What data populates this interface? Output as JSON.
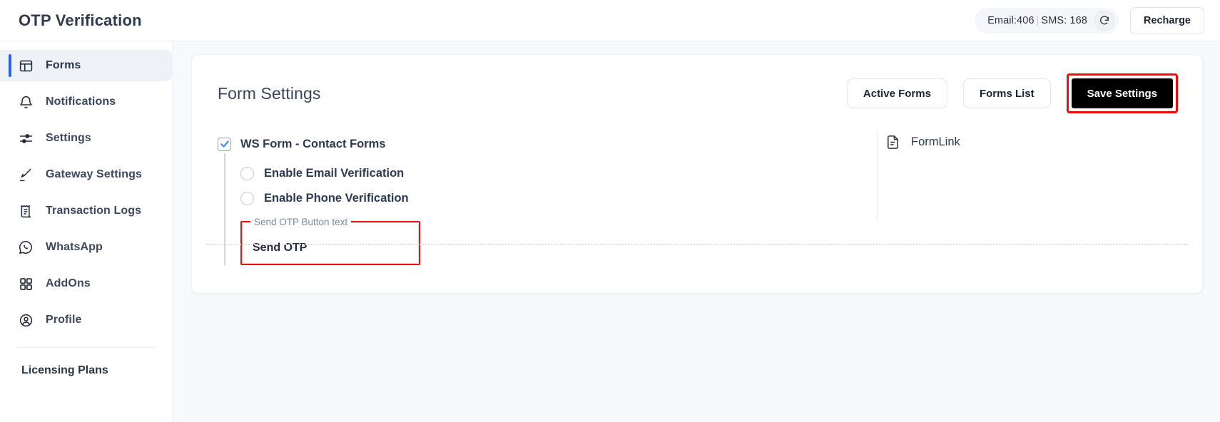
{
  "header": {
    "title": "OTP Verification",
    "credits": {
      "email_label": "Email:406",
      "separator": "|",
      "sms_label": "SMS: 168",
      "refresh_icon": "refresh-icon"
    },
    "recharge_label": "Recharge"
  },
  "sidebar": {
    "items": [
      {
        "label": "Forms",
        "icon": "layout-forms-icon",
        "active": true
      },
      {
        "label": "Notifications",
        "icon": "bell-icon",
        "active": false
      },
      {
        "label": "Settings",
        "icon": "sliders-icon",
        "active": false
      },
      {
        "label": "Gateway Settings",
        "icon": "brush-icon",
        "active": false
      },
      {
        "label": "Transaction Logs",
        "icon": "receipt-icon",
        "active": false
      },
      {
        "label": "WhatsApp",
        "icon": "whatsapp-icon",
        "active": false
      },
      {
        "label": "AddOns",
        "icon": "grid-squares-icon",
        "active": false
      },
      {
        "label": "Profile",
        "icon": "user-circle-icon",
        "active": false
      }
    ],
    "footer_item": "Licensing Plans"
  },
  "card": {
    "title": "Form Settings",
    "actions": {
      "active_forms": "Active Forms",
      "forms_list": "Forms List",
      "save_settings": "Save Settings"
    },
    "form": {
      "parent_checkbox": {
        "label": "WS Form - Contact Forms",
        "checked": true
      },
      "options": [
        {
          "label": "Enable Email Verification",
          "selected": false
        },
        {
          "label": "Enable Phone Verification",
          "selected": false
        }
      ],
      "otp_button_field": {
        "legend": "Send OTP Button text",
        "value": "Send OTP"
      }
    },
    "form_link": {
      "label": "FormLink",
      "icon": "document-icon"
    }
  },
  "colors": {
    "accent_blue": "#2563eb",
    "highlight_red": "#f10d0d",
    "save_button_bg": "#000000",
    "page_bg": "#f7f9fc"
  }
}
